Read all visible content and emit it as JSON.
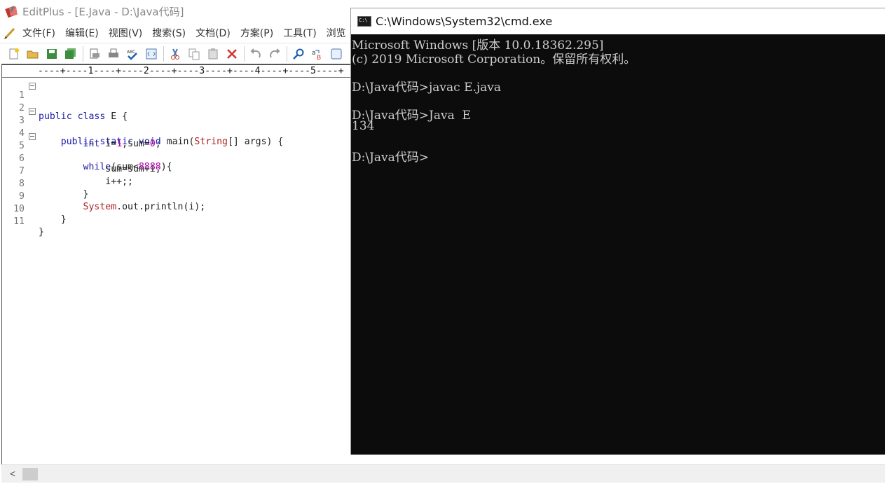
{
  "editplus": {
    "title": "EditPlus - [E.Java - D:\\Java代码]",
    "menu": [
      "文件(F)",
      "编辑(E)",
      "视图(V)",
      "搜索(S)",
      "文档(D)",
      "方案(P)",
      "工具(T)",
      "浏览"
    ],
    "toolbar": [
      "new-file-icon",
      "open-folder-icon",
      "save-icon",
      "save-all-icon",
      "print-preview-icon",
      "print-icon",
      "spellcheck-icon",
      "browser-preview-icon",
      "cut-icon",
      "copy-icon",
      "paste-icon",
      "delete-icon",
      "undo-icon",
      "redo-icon",
      "find-icon",
      "replace-icon",
      "browser-icon"
    ],
    "ruler": "----+----1----+----2----+----3----+----4----+----5----+",
    "lines": [
      {
        "n": "1",
        "fold": true
      },
      {
        "n": "2",
        "fold": false
      },
      {
        "n": "3",
        "fold": true
      },
      {
        "n": "4",
        "fold": false
      },
      {
        "n": "5",
        "fold": true
      },
      {
        "n": "6",
        "fold": false
      },
      {
        "n": "7",
        "fold": false
      },
      {
        "n": "8",
        "fold": false
      },
      {
        "n": "9",
        "fold": false
      },
      {
        "n": "10",
        "fold": false
      },
      {
        "n": "11",
        "fold": false
      }
    ],
    "code": {
      "l1_kw": "public class",
      "l1_rest": " E {",
      "l3_kw": "public static void",
      "l3_mid": " main(",
      "l3_type": "String",
      "l3_rest": "[] args) {",
      "l4_kw": "int",
      "l4_a": " i=",
      "l4_n1": "1",
      "l4_b": ",sum=",
      "l4_n2": "0",
      "l4_c": ";",
      "l5_kw": "while",
      "l5_a": "(sum<",
      "l5_n": "8888",
      "l5_b": "){",
      "l6": "sum=sum+i;",
      "l7": "i++;;",
      "l8": "}",
      "l9_type": "System",
      "l9_rest": ".out.println(i);",
      "l10": "}",
      "l11": "}"
    },
    "scroll_left": "<"
  },
  "cmd": {
    "title": "C:\\Windows\\System32\\cmd.exe",
    "lines": [
      "Microsoft Windows [版本 10.0.18362.295]",
      "(c) 2019 Microsoft Corporation。保留所有权利。",
      "",
      "D:\\Java代码>javac E.java",
      "",
      "D:\\Java代码>Java  E",
      "134",
      "",
      "D:\\Java代码>"
    ]
  },
  "colors": {
    "keyword": "#1a1aa6",
    "type": "#b22222",
    "number": "#b000b0",
    "console_bg": "#0c0c0c",
    "console_fg": "#cccccc"
  }
}
